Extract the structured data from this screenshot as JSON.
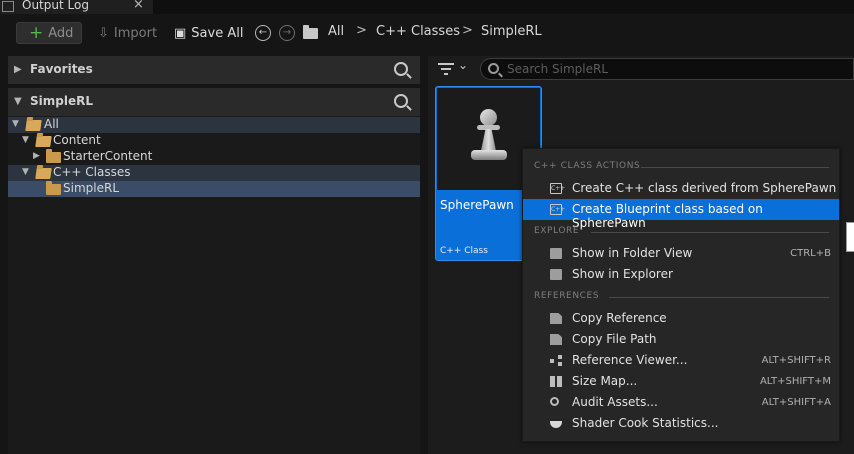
{
  "window_tab": {
    "label": "Output Log",
    "close_glyph": "×"
  },
  "toolbar": {
    "add_label": "Add",
    "import_label": "Import",
    "save_all_label": "Save All"
  },
  "breadcrumb": {
    "items": [
      "All",
      "C++ Classes",
      "SimpleRL"
    ],
    "separator": ">"
  },
  "left_panel": {
    "favorites": {
      "title": "Favorites"
    },
    "project": {
      "title": "SimpleRL"
    },
    "tree": [
      {
        "label": "All"
      },
      {
        "label": "Content"
      },
      {
        "label": "StarterContent"
      },
      {
        "label": "C++ Classes"
      },
      {
        "label": "SimpleRL"
      }
    ]
  },
  "right_panel": {
    "search_placeholder": "Search SimpleRL",
    "asset": {
      "name": "SpherePawn",
      "type": "C++ Class"
    }
  },
  "context_menu": {
    "sections": [
      {
        "title": "C++ CLASS ACTIONS",
        "items": [
          {
            "label": "Create C++ class derived from SpherePawn",
            "shortcut": "",
            "icon": "cpp-class-icon"
          },
          {
            "label": "Create Blueprint class based on SpherePawn",
            "shortcut": "",
            "icon": "cpp-class-icon",
            "highlighted": true
          }
        ]
      },
      {
        "title": "EXPLORE",
        "items": [
          {
            "label": "Show in Folder View",
            "shortcut": "CTRL+B",
            "icon": "folder-search-icon"
          },
          {
            "label": "Show in Explorer",
            "shortcut": "",
            "icon": "folder-search-icon"
          }
        ]
      },
      {
        "title": "REFERENCES",
        "items": [
          {
            "label": "Copy Reference",
            "shortcut": "",
            "icon": "copy-page-icon"
          },
          {
            "label": "Copy File Path",
            "shortcut": "",
            "icon": "copy-page-icon"
          },
          {
            "label": "Reference Viewer...",
            "shortcut": "ALT+SHIFT+R",
            "icon": "graph-icon"
          },
          {
            "label": "Size Map...",
            "shortcut": "ALT+SHIFT+M",
            "icon": "size-map-icon"
          },
          {
            "label": "Audit Assets...",
            "shortcut": "ALT+SHIFT+A",
            "icon": "audit-icon"
          },
          {
            "label": "Shader Cook Statistics...",
            "shortcut": "",
            "icon": "teapot-icon"
          }
        ]
      }
    ]
  },
  "colors": {
    "accent": "#0a6fd8",
    "folder": "#c99a4c",
    "add_plus": "#54b84b"
  }
}
